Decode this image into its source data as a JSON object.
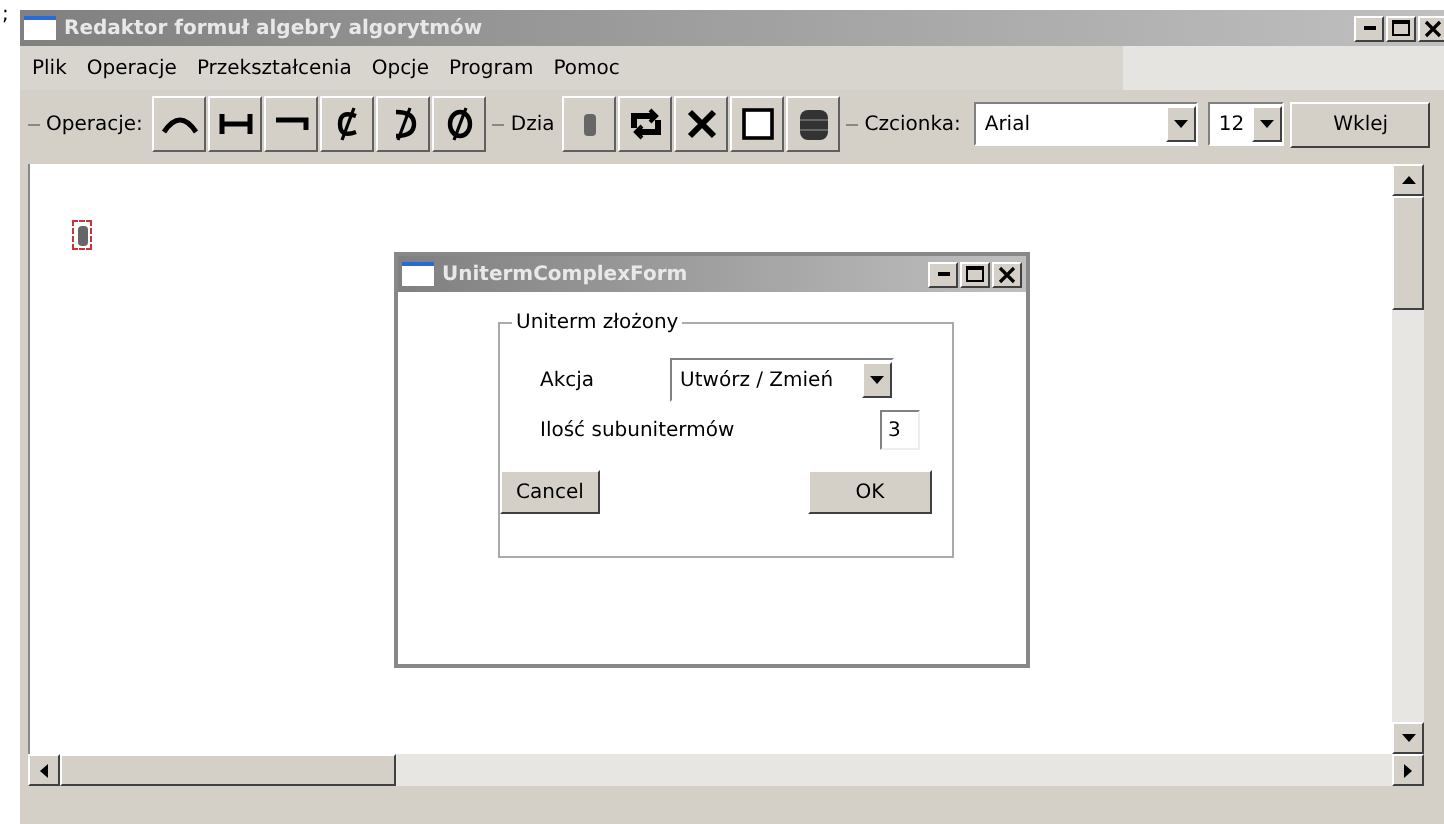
{
  "edge_mark": ";",
  "window": {
    "title": "Redaktor formuł algebry algorytmów"
  },
  "menu": [
    "Plik",
    "Operacje",
    "Przekształcenia",
    "Opcje",
    "Program",
    "Pomoc"
  ],
  "toolbar": {
    "operations_label": "Operacje:",
    "actions_label": "Dzia",
    "font_label": "Czcionka:",
    "font": "Arial",
    "size": "12",
    "paste_button": "Wklej"
  },
  "dialog": {
    "title": "UnitermComplexForm",
    "group_title": "Uniterm złożony",
    "action_label": "Akcja",
    "action_value": "Utwórz / Zmień",
    "count_label": "Ilość subunitermów",
    "count_value": "3",
    "cancel": "Cancel",
    "ok": "OK"
  }
}
